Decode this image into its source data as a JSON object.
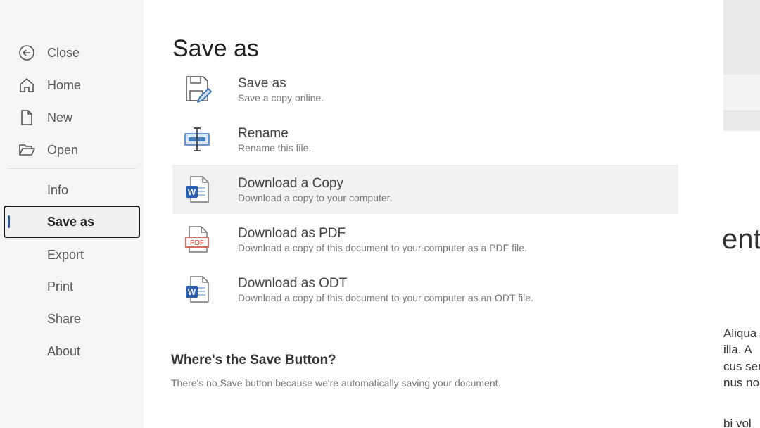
{
  "sidebar": {
    "items": [
      {
        "label": "Close"
      },
      {
        "label": "Home"
      },
      {
        "label": "New"
      },
      {
        "label": "Open"
      },
      {
        "label": "Info"
      },
      {
        "label": "Save as"
      },
      {
        "label": "Export"
      },
      {
        "label": "Print"
      },
      {
        "label": "Share"
      },
      {
        "label": "About"
      }
    ]
  },
  "main": {
    "title": "Save as",
    "options": [
      {
        "title": "Save as",
        "description": "Save a copy online.",
        "icon": "save-as-icon"
      },
      {
        "title": "Rename",
        "description": "Rename this file.",
        "icon": "rename-icon"
      },
      {
        "title": "Download a Copy",
        "description": "Download a copy to your computer.",
        "icon": "word-document-icon"
      },
      {
        "title": "Download as PDF",
        "description": "Download a copy of this document to your computer as a PDF file.",
        "icon": "pdf-document-icon"
      },
      {
        "title": "Download as ODT",
        "description": "Download a copy of this document to your computer as an ODT file.",
        "icon": "word-document-icon"
      }
    ],
    "info_heading": "Where's the Save Button?",
    "info_text": "There's no Save button because we're automatically saving your document."
  },
  "document": {
    "title_fragment": "ent",
    "lines": [
      "Aliqua",
      "illa. A",
      "cus ser",
      "nus no",
      "bi vol"
    ]
  },
  "colors": {
    "accent": "#2b579a",
    "word_blue": "#2b5fb3",
    "pdf_red": "#d23a2a"
  }
}
